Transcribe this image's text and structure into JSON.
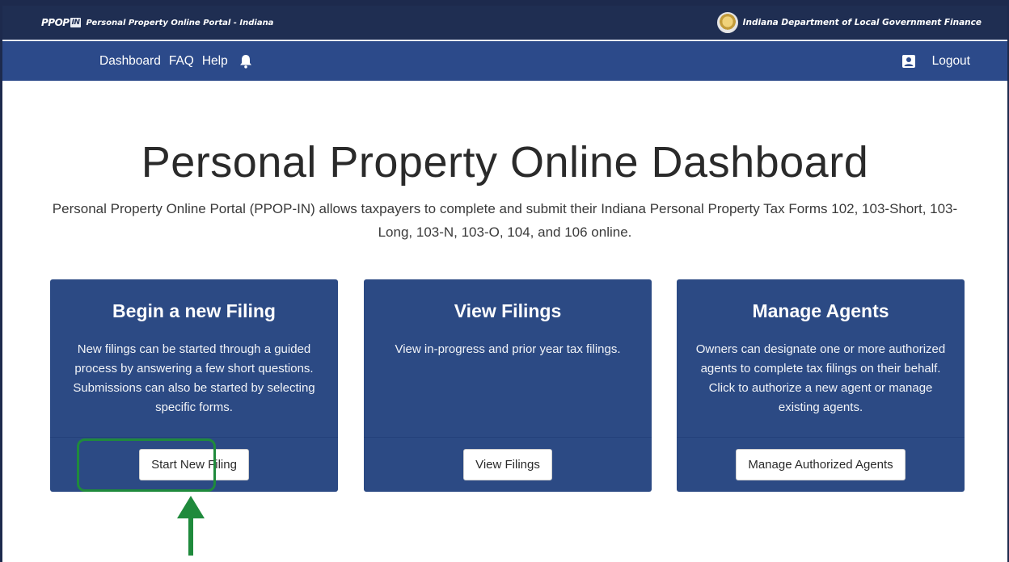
{
  "header": {
    "logo_text": "PPOP",
    "logo_in": "IN",
    "portal_title": "Personal Property Online Portal - Indiana",
    "department": "Indiana Department of Local Government Finance"
  },
  "nav": {
    "dashboard": "Dashboard",
    "faq": "FAQ",
    "help": "Help",
    "logout": "Logout"
  },
  "main": {
    "title": "Personal Property Online Dashboard",
    "description": "Personal Property Online Portal (PPOP-IN) allows taxpayers to complete and submit their Indiana Personal Property Tax Forms 102, 103-Short, 103-Long, 103-N, 103-O, 104, and 106 online."
  },
  "cards": [
    {
      "title": "Begin a new Filing",
      "text": "New filings can be started through a guided process by answering a few short questions. Submissions can also be started by selecting specific forms.",
      "button": "Start New Filing"
    },
    {
      "title": "View Filings",
      "text": "View in-progress and prior year tax filings.",
      "button": "View Filings"
    },
    {
      "title": "Manage Agents",
      "text": "Owners can designate one or more authorized agents to complete tax filings on their behalf. Click to authorize a new agent or manage existing agents.",
      "button": "Manage Authorized Agents"
    }
  ],
  "colors": {
    "topbar": "#1f2e52",
    "navbar": "#2c4a8a",
    "card": "#2c4a84",
    "highlight": "#1f8a3c"
  },
  "icons": {
    "bell": "bell-icon",
    "user": "user-icon",
    "seal": "seal-icon",
    "arrow": "arrow-up-icon"
  }
}
